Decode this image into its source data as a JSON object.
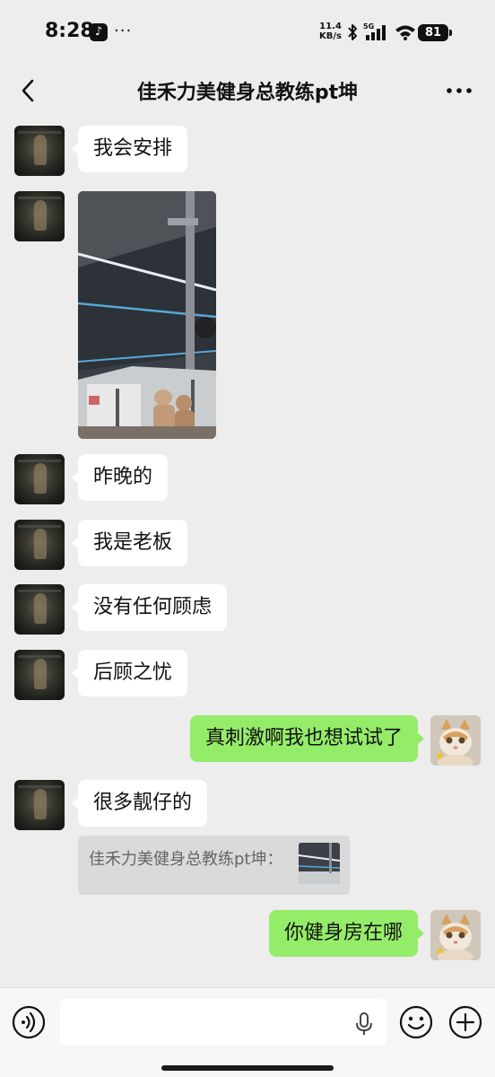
{
  "status_bar": {
    "time": "8:28",
    "dots": "···",
    "net_speed_value": "11.4",
    "net_speed_unit": "KB/s",
    "network": "5G",
    "battery": "81"
  },
  "header": {
    "title": "佳禾力美健身总教练pt坤"
  },
  "messages": [
    {
      "side": "left",
      "text": "我会安排"
    },
    {
      "side": "left",
      "type": "image"
    },
    {
      "side": "left",
      "text": "昨晚的"
    },
    {
      "side": "left",
      "text": "我是老板"
    },
    {
      "side": "left",
      "text": "没有任何顾虑"
    },
    {
      "side": "left",
      "text": "后顾之忧"
    },
    {
      "side": "right",
      "text": "真刺激啊我也想试试了"
    },
    {
      "side": "left",
      "text": "很多靓仔的"
    },
    {
      "side": "left",
      "type": "quote",
      "text": "佳禾力美健身总教练pt坤："
    },
    {
      "side": "right",
      "text": "你健身房在哪"
    }
  ],
  "colors": {
    "background": "#ededed",
    "sent_bubble": "#95ec69",
    "received_bubble": "#ffffff"
  },
  "icons": {
    "back": "chevron-left-icon",
    "menu": "more-horizontal-icon",
    "voice": "voice-input-icon",
    "mic": "microphone-icon",
    "emoji": "emoji-icon",
    "plus": "plus-icon"
  }
}
